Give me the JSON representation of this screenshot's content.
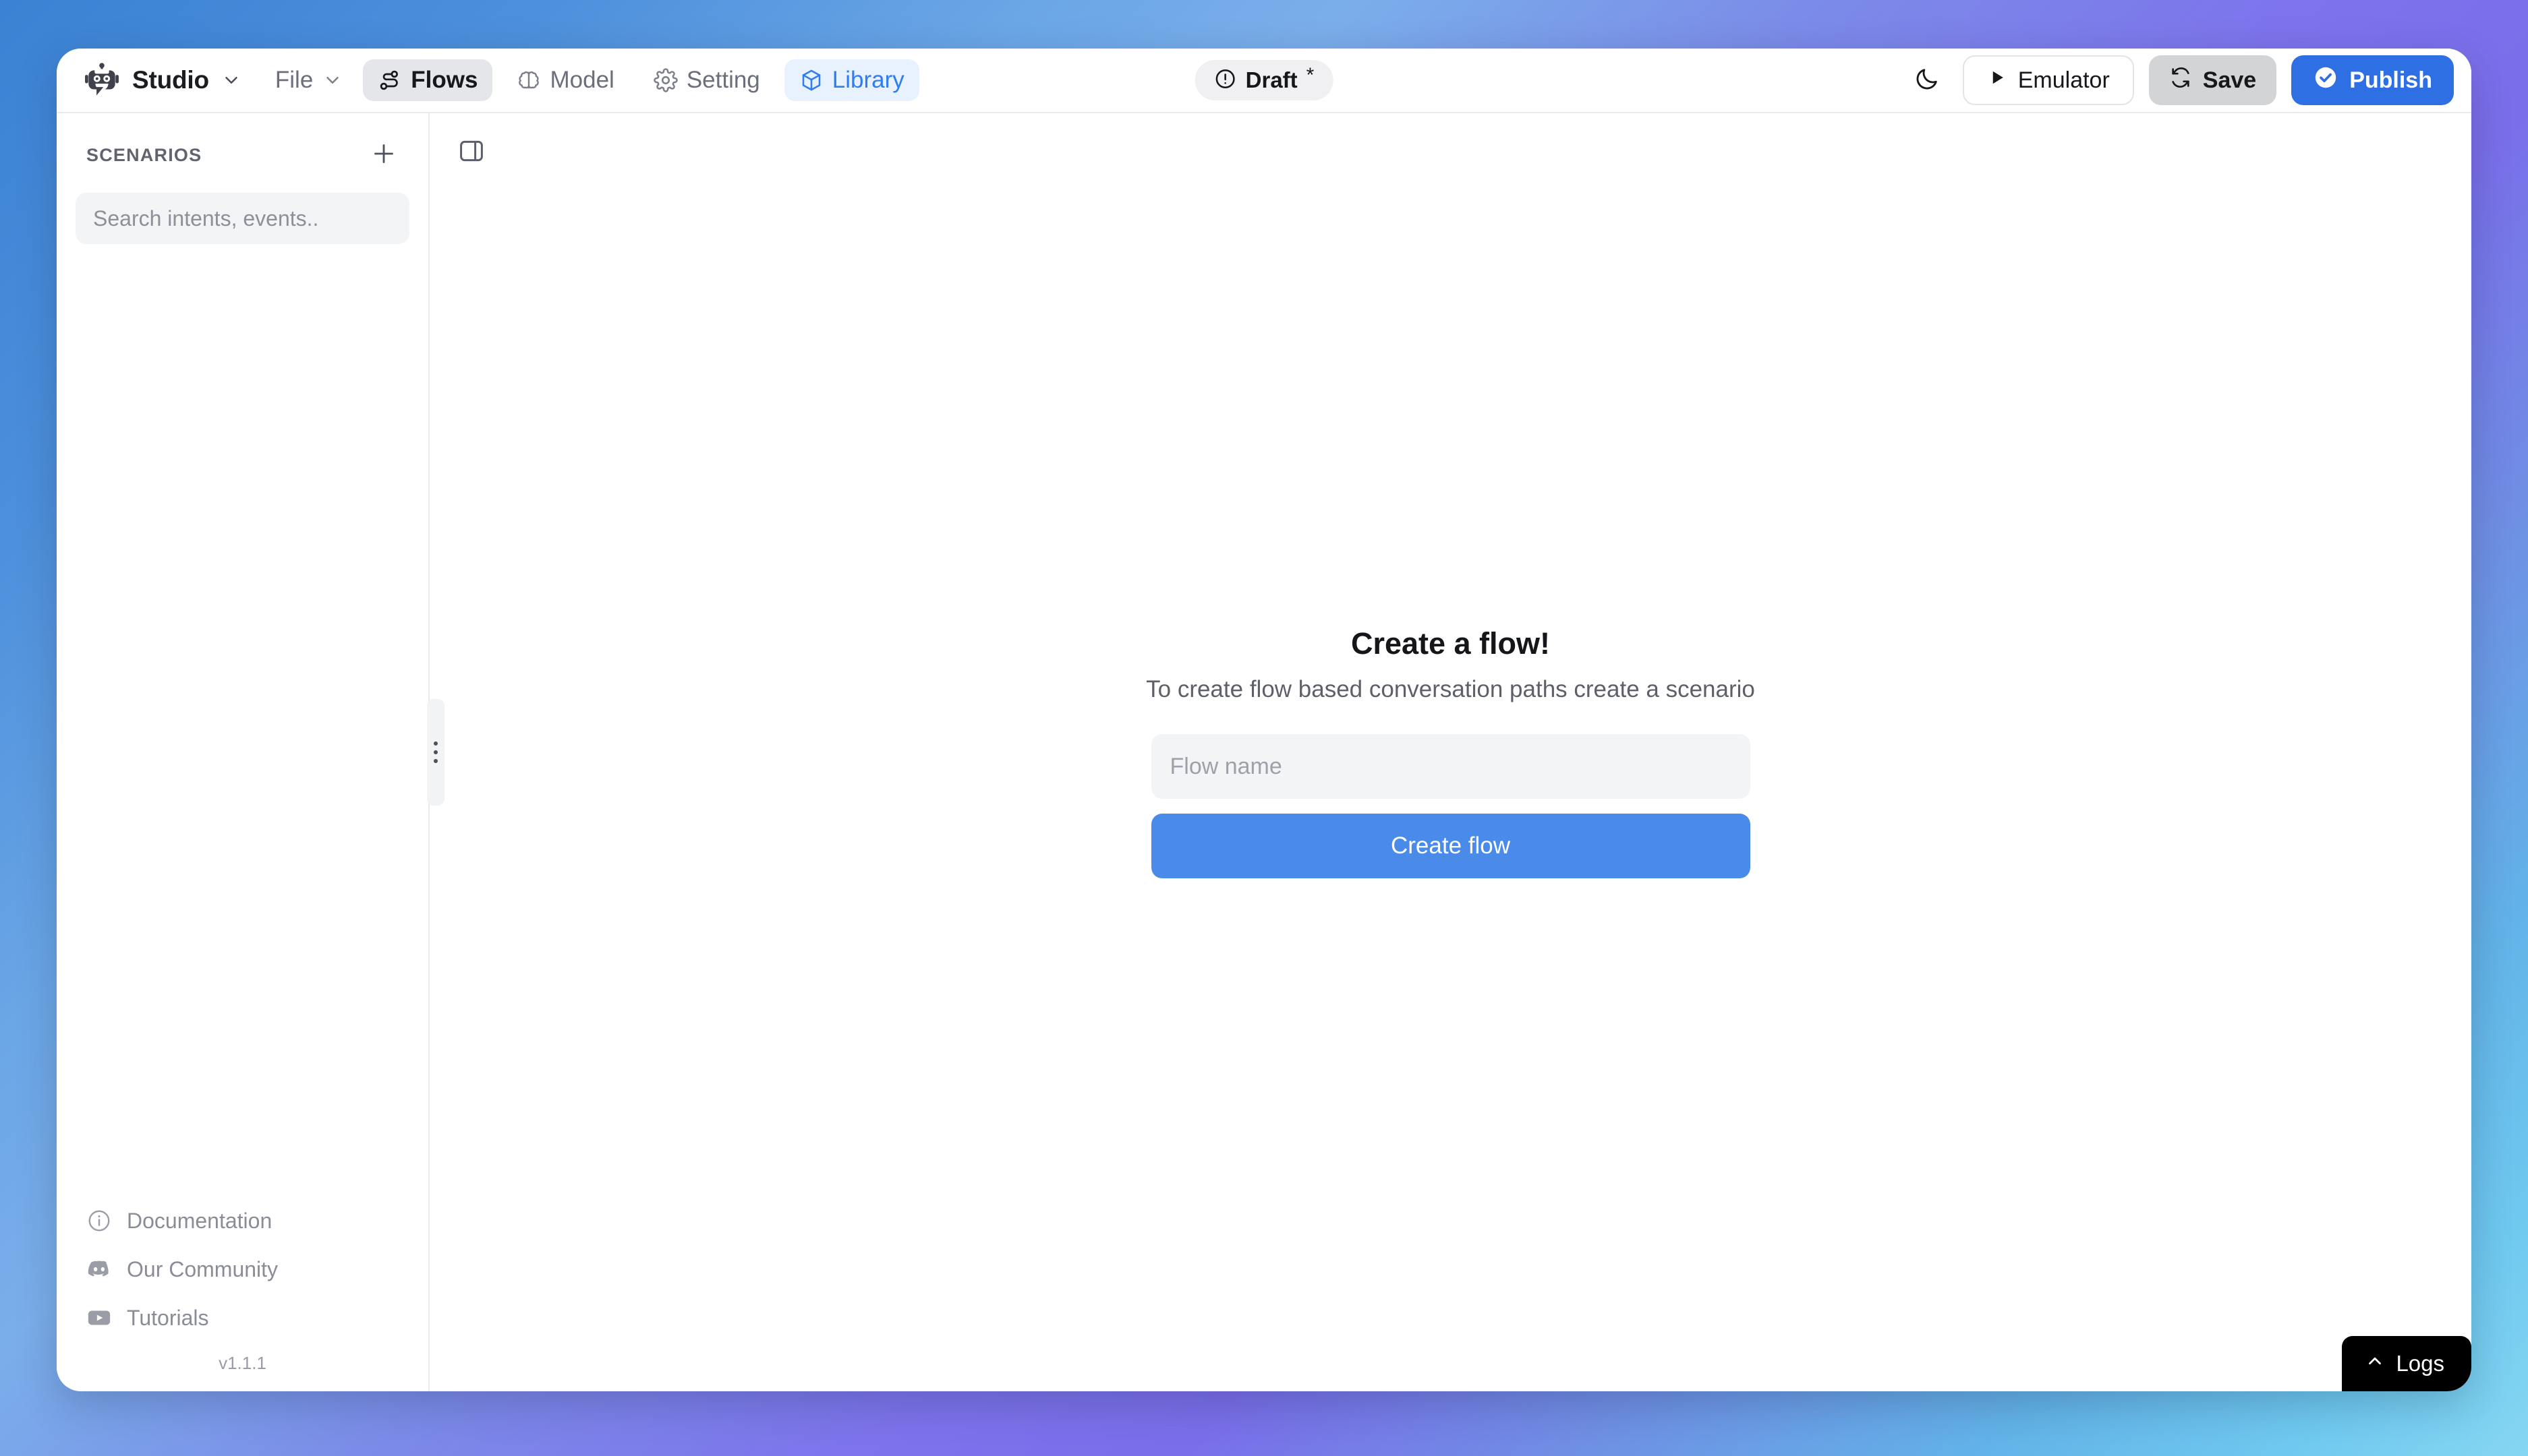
{
  "app": {
    "brand_name": "Studio",
    "brand_icon": "robot-icon",
    "brand_chevron": "chevron-down-icon"
  },
  "topbar": {
    "menu": [
      {
        "label": "File",
        "icon": "",
        "chevron": "chevron-down-icon",
        "state": "default"
      },
      {
        "label": "Flows",
        "icon": "flow-route-icon",
        "chevron": "",
        "state": "active-dark"
      },
      {
        "label": "Model",
        "icon": "brain-icon",
        "chevron": "",
        "state": "default"
      },
      {
        "label": "Setting",
        "icon": "gear-icon",
        "chevron": "",
        "state": "default"
      },
      {
        "label": "Library",
        "icon": "cube-icon",
        "chevron": "",
        "state": "active-blue"
      }
    ],
    "status": {
      "label": "Draft",
      "modified_marker": "*",
      "icon": "alert-circle-icon"
    },
    "theme_toggle_icon": "moon-icon",
    "emulator": {
      "label": "Emulator",
      "icon": "play-icon"
    },
    "save": {
      "label": "Save",
      "icon": "refresh-icon"
    },
    "publish": {
      "label": "Publish",
      "icon": "check-circle-icon"
    }
  },
  "sidebar": {
    "section_title": "SCENARIOS",
    "add_icon": "plus-icon",
    "search": {
      "placeholder": "Search intents, events..",
      "value": ""
    },
    "links": [
      {
        "label": "Documentation",
        "icon": "info-circle-icon"
      },
      {
        "label": "Our Community",
        "icon": "discord-icon"
      },
      {
        "label": "Tutorials",
        "icon": "youtube-icon"
      }
    ],
    "version": "v1.1.1",
    "resize_handle": "sidebar-resize-handle"
  },
  "canvas": {
    "panel_toggle_icon": "panel-toggle-icon",
    "empty_state": {
      "title": "Create a flow!",
      "subtitle": "To create flow based conversation paths create a scenario",
      "input_placeholder": "Flow name",
      "input_value": "",
      "button_label": "Create flow"
    },
    "logs": {
      "label": "Logs",
      "icon": "chevron-up-icon"
    }
  },
  "colors": {
    "accent_blue": "#2f6fe4",
    "create_blue": "#4a8bea",
    "library_blue": "#2f7df0",
    "library_bg": "#e8f1fe",
    "save_grey": "#d3d4d6",
    "logs_black": "#000000",
    "muted_text": "#8a8d96",
    "panel_bg": "#ffffff",
    "field_bg": "#f3f4f6"
  }
}
